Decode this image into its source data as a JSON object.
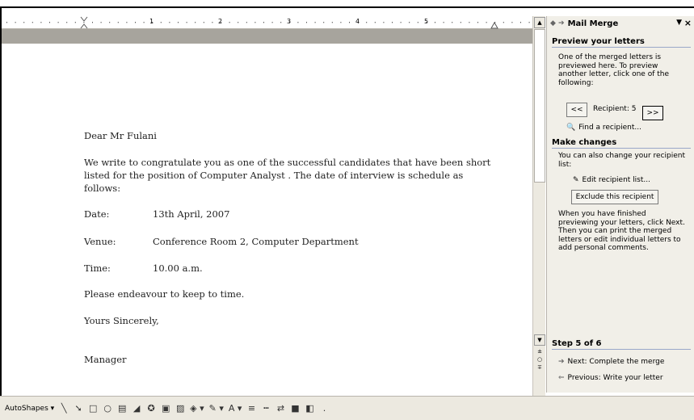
{
  "ruler": {
    "marks": [
      "1",
      "2",
      "3",
      "4",
      "5"
    ]
  },
  "letter": {
    "salutation": "Dear Mr Fulani",
    "body_line1": "We write to congratulate you as one of the successful candidates that have been short",
    "body_line2": "listed for the position of  Computer Analyst . The date of interview is schedule as",
    "body_line3": "follows:",
    "date_label": "Date:",
    "date_value": "13th April, 2007",
    "venue_label": "Venue:",
    "venue_value": "Conference Room 2, Computer Department",
    "time_label": "Time:",
    "time_value": "10.00 a.m.",
    "closing_note": "Please endeavour to keep to time.",
    "signoff": "Yours Sincerely,",
    "signature": "Manager"
  },
  "taskpane": {
    "title": "Mail Merge",
    "preview_heading": "Preview your letters",
    "preview_text": "One of the merged letters is previewed here. To preview another letter, click one of the following:",
    "prev_button": "<<",
    "recipient_label": "Recipient: 5",
    "next_button": ">>",
    "find_recipient": "Find a recipient...",
    "changes_heading": "Make changes",
    "changes_text": "You can also change your recipient list:",
    "edit_list": "Edit recipient list...",
    "exclude_button": "Exclude this recipient",
    "finish_text": "When you have finished previewing your letters, click Next. Then you can print the merged letters or edit individual letters to add personal comments.",
    "step_heading": "Step 5 of 6",
    "next_step": "Next: Complete the merge",
    "prev_step": "Previous: Write your letter"
  },
  "drawbar": {
    "autoshapes": "AutoShapes ▾"
  }
}
